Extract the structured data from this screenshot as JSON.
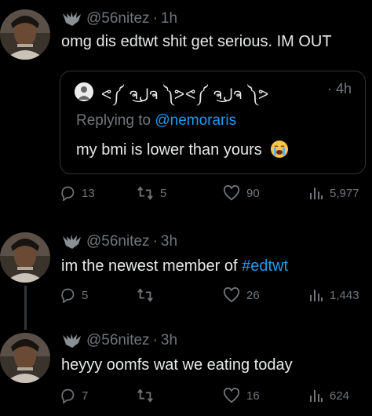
{
  "tweets": [
    {
      "handle": "@56nitez",
      "separator": "·",
      "time": "1h",
      "text": "omg dis edtwt shit get serious. IM OUT",
      "quote": {
        "name": "ᕙ༼ ຈل͜ຈ ༽ᕗᕙ༼ ຈل͜ຈ ༽ᕗ",
        "separator": "·",
        "time": "4h",
        "replying_prefix": "Replying to ",
        "replying_handle": "@nemoraris",
        "text": "my bmi is lower than yours"
      },
      "stats": {
        "replies": "13",
        "reposts": "5",
        "likes": "90",
        "views": "5,977"
      }
    },
    {
      "handle": "@56nitez",
      "separator": "·",
      "time": "3h",
      "text_prefix": "im the newest member of ",
      "hashtag": "#edtwt",
      "stats": {
        "replies": "5",
        "reposts": "",
        "likes": "26",
        "views": "1,443"
      }
    },
    {
      "handle": "@56nitez",
      "separator": "·",
      "time": "3h",
      "text": "heyyy oomfs wat we eating today",
      "stats": {
        "replies": "7",
        "reposts": "",
        "likes": "16",
        "views": "624"
      }
    }
  ],
  "colors": {
    "background": "#000000",
    "text": "#e7e9ea",
    "muted": "#71767b",
    "link": "#1d9bf0",
    "border": "#2f3336"
  },
  "icons": [
    "bat-icon",
    "reply-icon",
    "repost-icon",
    "like-icon",
    "views-icon"
  ]
}
